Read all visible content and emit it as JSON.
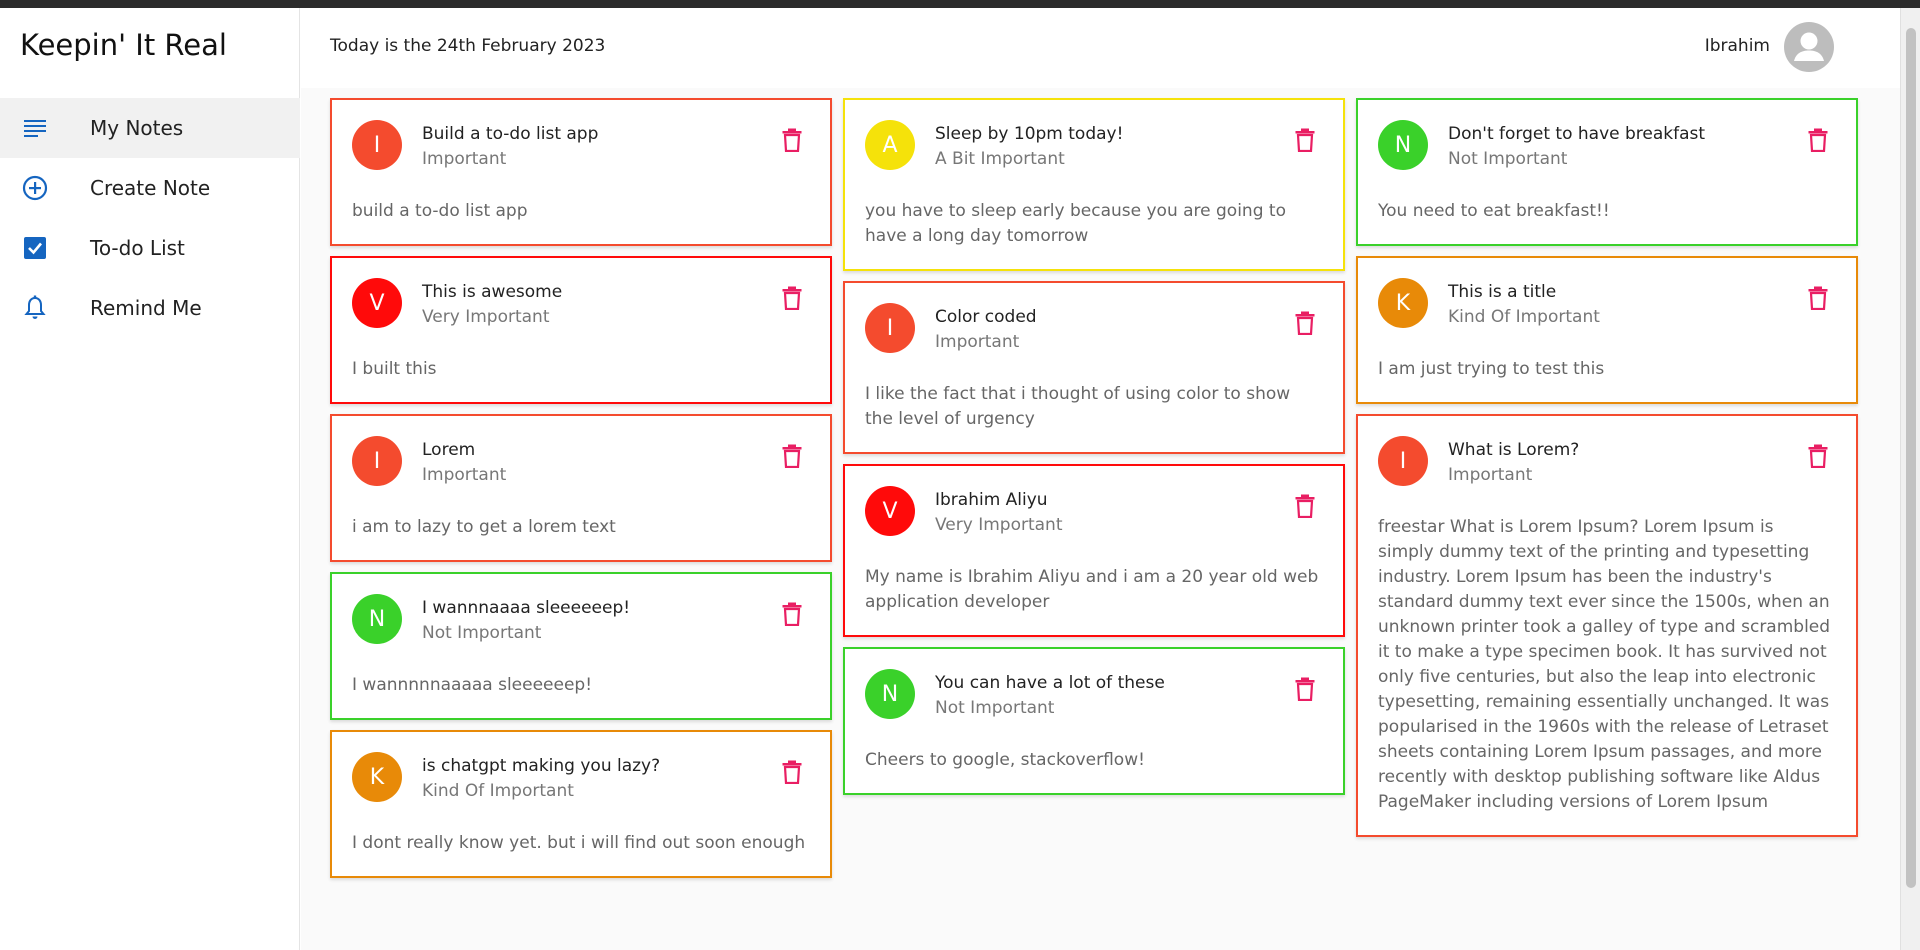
{
  "app": {
    "brand": "Keepin' It Real"
  },
  "sidebar": {
    "items": [
      {
        "label": "My Notes",
        "icon": "list-icon",
        "active": true
      },
      {
        "label": "Create Note",
        "icon": "add-circle-icon",
        "active": false
      },
      {
        "label": "To-do List",
        "icon": "checkbox-icon",
        "active": false
      },
      {
        "label": "Remind Me",
        "icon": "bell-icon",
        "active": false
      }
    ]
  },
  "header": {
    "date": "Today is the 24th February 2023",
    "user": "Ibrahim"
  },
  "colors": {
    "important": "#f44b2e",
    "very_important": "#ff0a0a",
    "a_bit_important": "#f5e20a",
    "not_important": "#3ad12a",
    "kind_of_important": "#e88a08",
    "accent": "#1565c0",
    "trash": "#e91e63"
  },
  "columns": [
    [
      {
        "initial": "I",
        "title": "Build a to-do list app",
        "category": "Important",
        "text": "build a to-do list app",
        "level": "important"
      },
      {
        "initial": "V",
        "title": "This is awesome",
        "category": "Very Important",
        "text": "I built this",
        "level": "very_important"
      },
      {
        "initial": "I",
        "title": "Lorem",
        "category": "Important",
        "text": "i am to lazy to get a lorem text",
        "level": "important"
      },
      {
        "initial": "N",
        "title": "I wannnaaaa sleeeeeep!",
        "category": "Not Important",
        "text": "I wannnnnaaaaa sleeeeeep!",
        "level": "not_important"
      },
      {
        "initial": "K",
        "title": "is chatgpt making you lazy?",
        "category": "Kind Of Important",
        "text": "I dont really know yet. but i will find out soon enough",
        "level": "kind_of_important"
      }
    ],
    [
      {
        "initial": "A",
        "title": "Sleep by 10pm today!",
        "category": "A Bit Important",
        "text": "you have to sleep early because you are going to have a long day tomorrow",
        "level": "a_bit_important"
      },
      {
        "initial": "I",
        "title": "Color coded",
        "category": "Important",
        "text": "I like the fact that i thought of using color to show the level of urgency",
        "level": "important"
      },
      {
        "initial": "V",
        "title": "Ibrahim Aliyu",
        "category": "Very Important",
        "text": "My name is Ibrahim Aliyu and i am a 20 year old web application developer",
        "level": "very_important"
      },
      {
        "initial": "N",
        "title": "You can have a lot of these",
        "category": "Not Important",
        "text": "Cheers to google, stackoverflow!",
        "level": "not_important"
      }
    ],
    [
      {
        "initial": "N",
        "title": "Don't forget to have breakfast",
        "category": "Not Important",
        "text": "You need to eat breakfast!!",
        "level": "not_important"
      },
      {
        "initial": "K",
        "title": "This is a title",
        "category": "Kind Of Important",
        "text": "I am just trying to test this",
        "level": "kind_of_important"
      },
      {
        "initial": "I",
        "title": "What is Lorem?",
        "category": "Important",
        "text": "freestar What is Lorem Ipsum? Lorem Ipsum is simply dummy text of the printing and typesetting industry. Lorem Ipsum has been the industry's standard dummy text ever since the 1500s, when an unknown printer took a galley of type and scrambled it to make a type specimen book. It has survived not only five centuries, but also the leap into electronic typesetting, remaining essentially unchanged. It was popularised in the 1960s with the release of Letraset sheets containing Lorem Ipsum passages, and more recently with desktop publishing software like Aldus PageMaker including versions of Lorem Ipsum",
        "level": "important"
      }
    ]
  ]
}
